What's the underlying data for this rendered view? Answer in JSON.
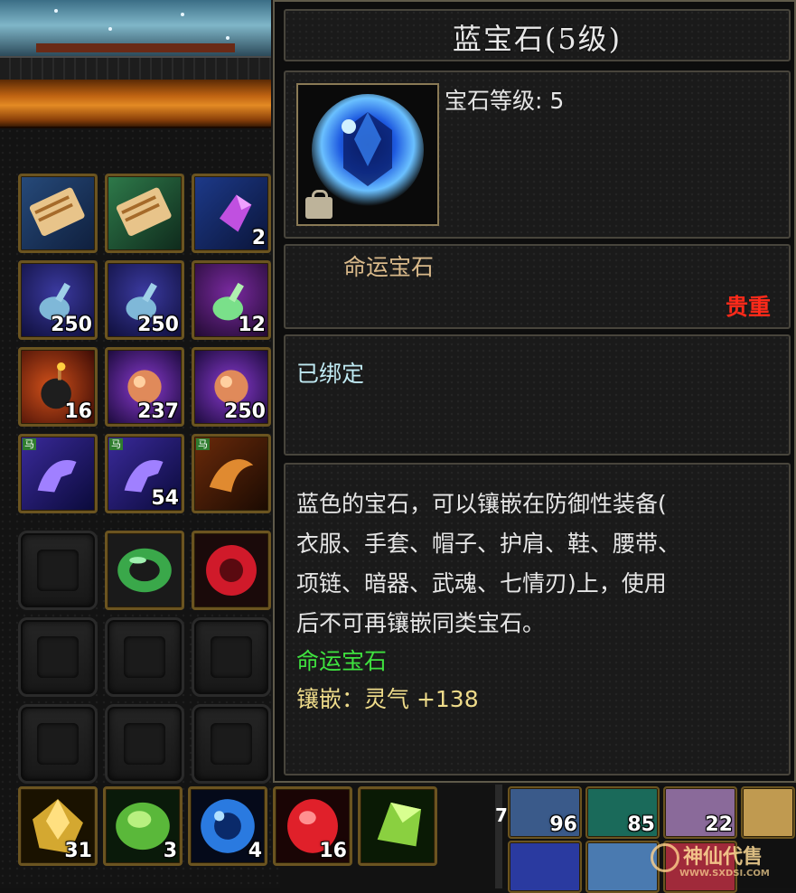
{
  "tooltip": {
    "title": "蓝宝石(5级)",
    "gem_level": "宝石等级: 5",
    "category": "命运宝石",
    "rarity": "贵重",
    "bind_status": "已绑定",
    "description_lines": [
      "蓝色的宝石，可以镶嵌在防御性装备(",
      "衣服、手套、帽子、护肩、鞋、腰带、",
      "项链、暗器、武魂、七情刃)上，使用",
      "后不可再镶嵌同类宝石。"
    ],
    "effect_category": "命运宝石",
    "effect": "镶嵌：灵气 +138"
  },
  "inventory": {
    "rows": [
      [
        {
          "icon": "scroll-icon",
          "count": ""
        },
        {
          "icon": "scroll-icon",
          "count": ""
        },
        {
          "icon": "crystal-icon",
          "count": "2"
        }
      ],
      [
        {
          "icon": "potion-bottle-icon",
          "count": "250"
        },
        {
          "icon": "potion-bottle-icon",
          "count": "250"
        },
        {
          "icon": "potion-bottle-icon",
          "count": "12"
        }
      ],
      [
        {
          "icon": "bomb-icon",
          "count": "16"
        },
        {
          "icon": "orb-icon",
          "count": "237"
        },
        {
          "icon": "orb-icon",
          "count": "250"
        }
      ],
      [
        {
          "icon": "horse-card-icon",
          "count": ""
        },
        {
          "icon": "horse-card-icon",
          "count": "54"
        },
        {
          "icon": "phoenix-card-icon",
          "count": ""
        }
      ]
    ],
    "equip_row": [
      {
        "icon": "empty-slot",
        "count": ""
      },
      {
        "icon": "jade-bracelet-icon",
        "count": ""
      },
      {
        "icon": "red-gem-icon",
        "count": ""
      }
    ],
    "bottom_row": [
      {
        "icon": "yellow-gem-icon",
        "count": "31"
      },
      {
        "icon": "green-gem-icon",
        "count": "3"
      },
      {
        "icon": "blue-gem-icon",
        "count": "4"
      },
      {
        "icon": "red-gem-icon",
        "count": "16"
      },
      {
        "icon": "peridot-gem-icon",
        "count": ""
      }
    ],
    "right_fragment_counts": [
      "7",
      "96",
      "85",
      "22"
    ]
  },
  "watermark": "神仙代售",
  "watermark_url": "WWW.SXDSI.COM",
  "colors": {
    "rarity_red": "#ff2a1a",
    "category_green": "#3fe23f",
    "effect_yellow": "#eedb8a",
    "bind_cyan": "#bfe9f2",
    "slot_gold": "#6b5420"
  }
}
